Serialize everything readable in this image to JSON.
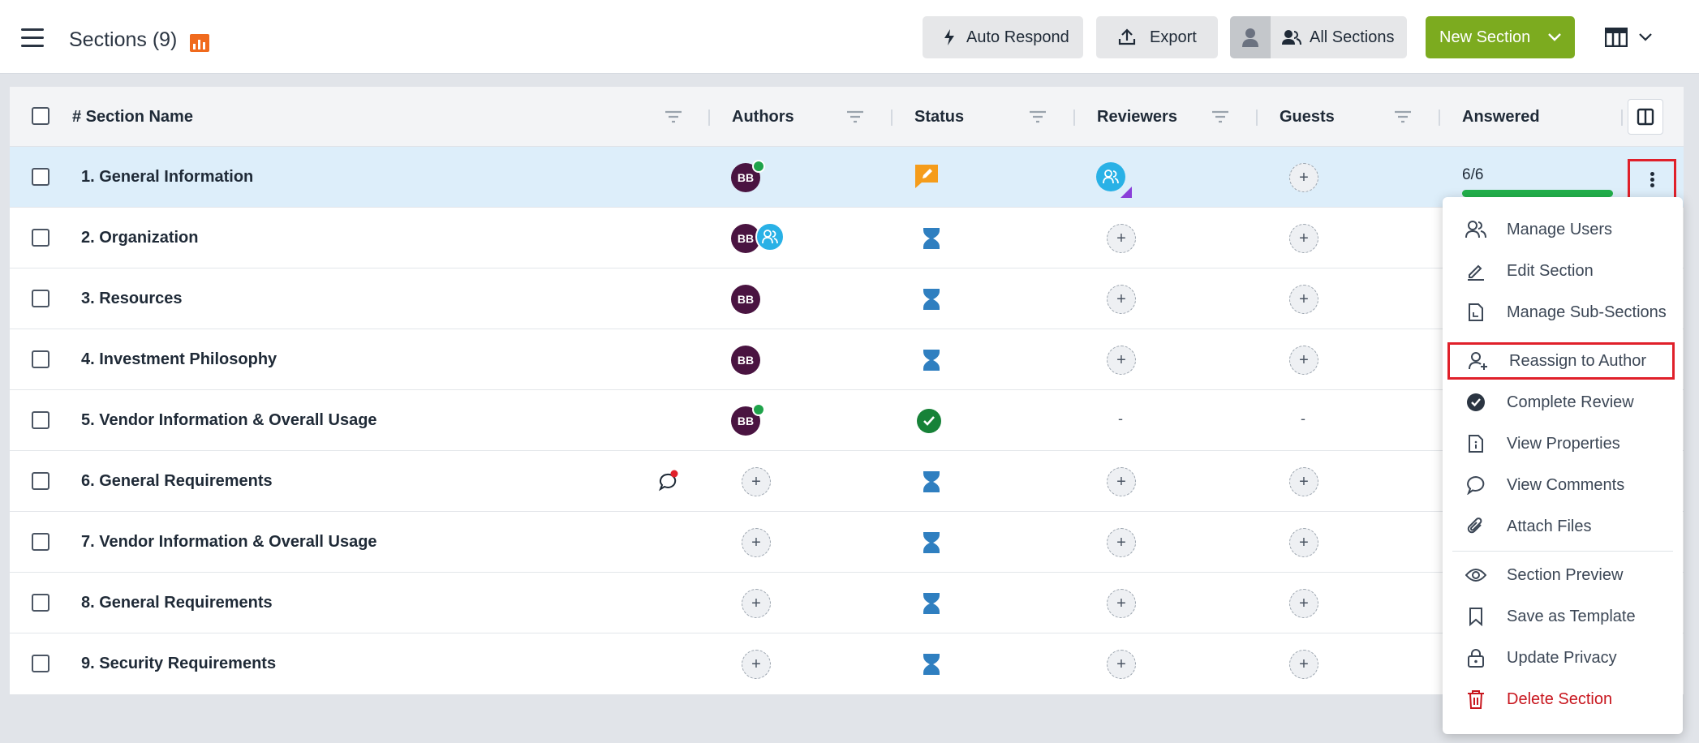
{
  "header": {
    "title": "Sections (9)",
    "buttons": {
      "auto_respond": "Auto Respond",
      "export": "Export",
      "all_sections": "All Sections",
      "new_section": "New Section"
    }
  },
  "table": {
    "columns": {
      "section_name": "# Section Name",
      "authors": "Authors",
      "status": "Status",
      "reviewers": "Reviewers",
      "guests": "Guests",
      "answered": "Answered"
    },
    "rows": [
      {
        "name": "1. General Information",
        "author_initials": "BB",
        "answered": "6/6",
        "answered_fraction": 1.0
      },
      {
        "name": "2. Organization",
        "author_initials": "BB"
      },
      {
        "name": "3. Resources",
        "author_initials": "BB"
      },
      {
        "name": "4. Investment Philosophy",
        "author_initials": "BB"
      },
      {
        "name": "5. Vendor Information & Overall Usage",
        "author_initials": "BB",
        "reviewers": "-",
        "guests": "-"
      },
      {
        "name": "6. General Requirements"
      },
      {
        "name": "7. Vendor Information & Overall Usage"
      },
      {
        "name": "8. General Requirements"
      },
      {
        "name": "9. Security Requirements"
      }
    ]
  },
  "menu": {
    "items": [
      "Manage Users",
      "Edit Section",
      "Manage Sub-Sections",
      "Reassign to Author",
      "Complete Review",
      "View Properties",
      "View Comments",
      "Attach Files",
      "Section Preview",
      "Save as Template",
      "Update Privacy",
      "Delete Section"
    ]
  },
  "colors": {
    "accent_green": "#7cab1f",
    "progress_green": "#22b04b",
    "author_avatar": "#4a1441",
    "status_pending": "#2f7fc0",
    "status_edit": "#f59c1a",
    "status_done": "#178238",
    "danger": "#c8161e",
    "highlight_border": "#e0202a",
    "selected_row": "#ddeefa"
  }
}
